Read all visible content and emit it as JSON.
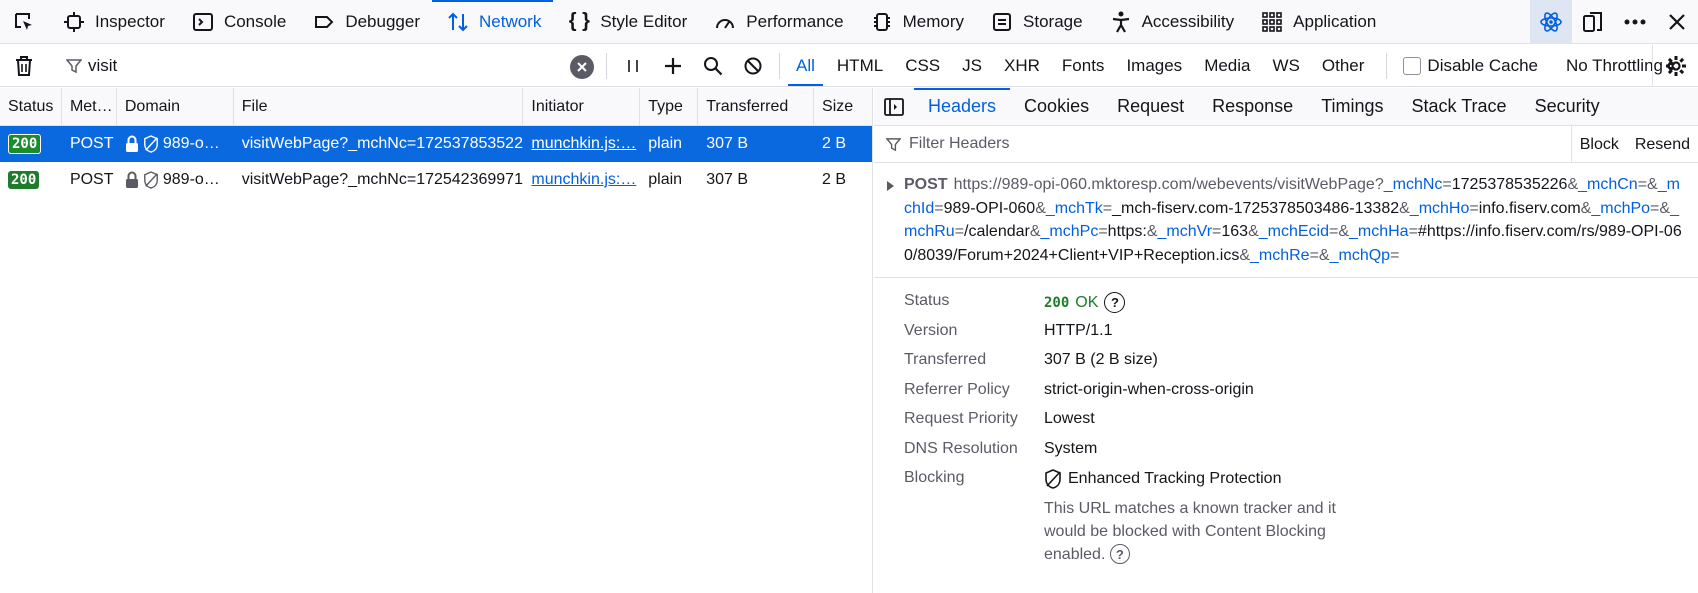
{
  "toolbox": {
    "tabs": [
      {
        "label": "Inspector",
        "icon": "inspector-icon"
      },
      {
        "label": "Console",
        "icon": "console-icon"
      },
      {
        "label": "Debugger",
        "icon": "debugger-icon"
      },
      {
        "label": "Network",
        "icon": "network-icon",
        "active": true
      },
      {
        "label": "Style Editor",
        "icon": "style-editor-icon"
      },
      {
        "label": "Performance",
        "icon": "performance-icon"
      },
      {
        "label": "Memory",
        "icon": "memory-icon"
      },
      {
        "label": "Storage",
        "icon": "storage-icon"
      },
      {
        "label": "Accessibility",
        "icon": "accessibility-icon"
      },
      {
        "label": "Application",
        "icon": "application-icon"
      }
    ]
  },
  "filterbar": {
    "url_filter_value": "visit",
    "type_filters": [
      "All",
      "HTML",
      "CSS",
      "JS",
      "XHR",
      "Fonts",
      "Images",
      "Media",
      "WS",
      "Other"
    ],
    "active_type": "All",
    "disable_cache_label": "Disable Cache",
    "throttle_label": "No Throttling"
  },
  "table": {
    "columns": [
      "Status",
      "Met…",
      "Domain",
      "File",
      "Initiator",
      "Type",
      "Transferred",
      "Size"
    ],
    "rows": [
      {
        "status": "200",
        "method": "POST",
        "domain": "989-o…",
        "file": "visitWebPage?_mchNc=172537853522(",
        "initiator": "munchkin.js:…",
        "type": "plain",
        "transferred": "307 B",
        "size": "2 B",
        "selected": true
      },
      {
        "status": "200",
        "method": "POST",
        "domain": "989-o…",
        "file": "visitWebPage?_mchNc=172542369971",
        "initiator": "munchkin.js:…",
        "type": "plain",
        "transferred": "307 B",
        "size": "2 B",
        "selected": false
      }
    ]
  },
  "details": {
    "tabs": [
      "Headers",
      "Cookies",
      "Request",
      "Response",
      "Timings",
      "Stack Trace",
      "Security"
    ],
    "active_tab": "Headers",
    "filter_placeholder": "Filter Headers",
    "block_label": "Block",
    "resend_label": "Resend",
    "method": "POST",
    "url_base": "https://989-opi-060.mktoresp.com/webevents/visitWebPage",
    "params": [
      {
        "k": "_mchNc",
        "v": "1725378535226"
      },
      {
        "k": "_mchCn",
        "v": ""
      },
      {
        "k": "_mchId",
        "v": "989-OPI-060"
      },
      {
        "k": "_mchTk",
        "v": "_mch-fiserv.com-1725378503486-13382"
      },
      {
        "k": "_mchHo",
        "v": "info.fiserv.com"
      },
      {
        "k": "_mchPo",
        "v": ""
      },
      {
        "k": "_mchRu",
        "v": "/calendar"
      },
      {
        "k": "_mchPc",
        "v": "https:"
      },
      {
        "k": "_mchVr",
        "v": "163"
      },
      {
        "k": "_mchEcid",
        "v": ""
      },
      {
        "k": "_mchHa",
        "v": "#https://info.fiserv.com/rs/989-OPI-060/8039/Forum+2024+Client+VIP+Reception.ics"
      },
      {
        "k": "_mchRe",
        "v": ""
      },
      {
        "k": "_mchQp",
        "v": ""
      }
    ],
    "props": {
      "status_label": "Status",
      "status_code": "200",
      "status_text": "OK",
      "version_label": "Version",
      "version": "HTTP/1.1",
      "transferred_label": "Transferred",
      "transferred": "307 B (2 B size)",
      "referrer_label": "Referrer Policy",
      "referrer": "strict-origin-when-cross-origin",
      "priority_label": "Request Priority",
      "priority": "Lowest",
      "dns_label": "DNS Resolution",
      "dns": "System",
      "blocking_label": "Blocking",
      "blocking": "Enhanced Tracking Protection",
      "blocking_note": "This URL matches a known tracker and it would be blocked with Content Blocking enabled."
    }
  }
}
